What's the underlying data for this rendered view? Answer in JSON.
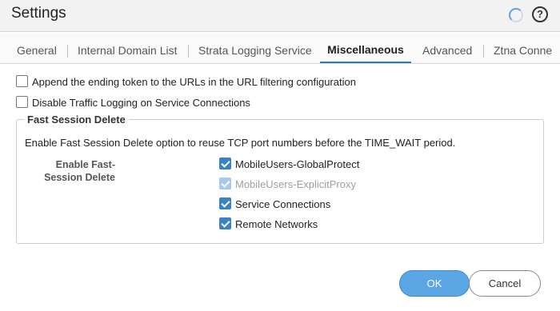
{
  "dialog": {
    "title": "Settings",
    "help_symbol": "?"
  },
  "tabs": [
    {
      "label": "General"
    },
    {
      "label": "Internal Domain List"
    },
    {
      "label": "Strata Logging Service"
    },
    {
      "label": "Miscellaneous",
      "active": true
    },
    {
      "label": "Advanced"
    },
    {
      "label": "Ztna Conne"
    }
  ],
  "options": {
    "append_token": {
      "label": "Append the ending token to the URLs in the URL filtering configuration",
      "checked": false
    },
    "disable_logging": {
      "label": "Disable Traffic Logging on Service Connections",
      "checked": false
    }
  },
  "fast_session": {
    "legend": "Fast Session Delete",
    "description": "Enable Fast Session Delete option to reuse TCP port numbers before the TIME_WAIT period.",
    "field_label": "Enable Fast-Session Delete",
    "items": [
      {
        "label": "MobileUsers-GlobalProtect",
        "checked": true,
        "disabled": false
      },
      {
        "label": "MobileUsers-ExplicitProxy",
        "checked": true,
        "disabled": true
      },
      {
        "label": "Service Connections",
        "checked": true,
        "disabled": false
      },
      {
        "label": "Remote Networks",
        "checked": true,
        "disabled": false
      }
    ]
  },
  "buttons": {
    "ok": "OK",
    "cancel": "Cancel"
  },
  "colors": {
    "accent": "#3b82c4",
    "ok_button": "#5ba7e6",
    "active_tab_underline": "#2d77c4"
  },
  "icons": [
    "loading-spinner-icon",
    "help-icon",
    "checkbox-checked-icon"
  ]
}
